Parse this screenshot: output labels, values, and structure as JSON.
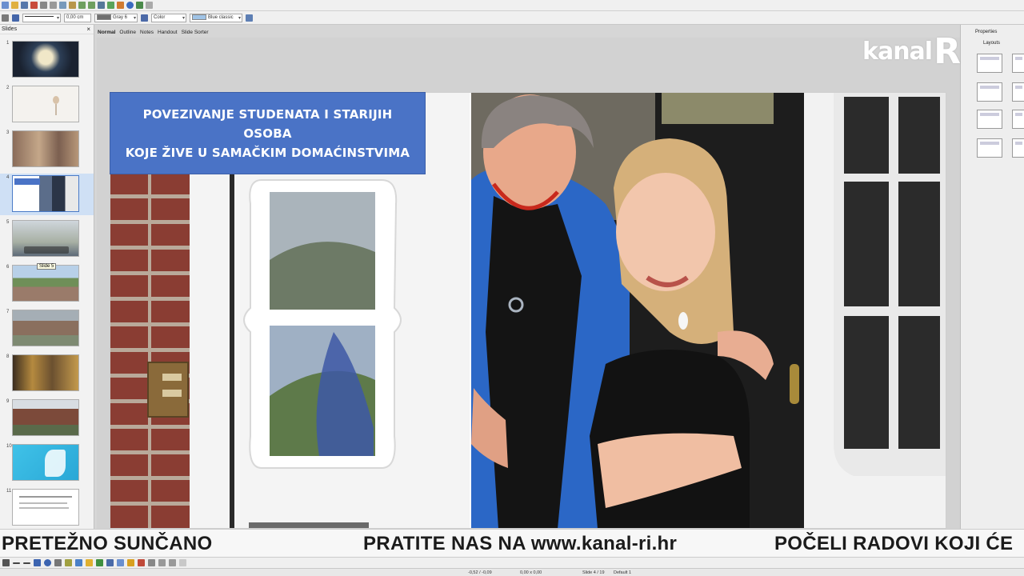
{
  "toolbar": {
    "line_width": "0,00 cm",
    "area_color_name": "Gray 6",
    "area_style": "Color",
    "fill_color_name": "Blue classic"
  },
  "slides_pane": {
    "title": "Slides",
    "close": "×",
    "numbers": [
      "1",
      "2",
      "3",
      "4",
      "5",
      "6",
      "7",
      "8",
      "9",
      "10",
      "11"
    ],
    "tooltip": "Slide 5"
  },
  "view_tabs": [
    "Normal",
    "Outline",
    "Notes",
    "Handout",
    "Slide Sorter"
  ],
  "slide": {
    "title_line1": "POVEZIVANJE STUDENATA I STARIJIH OSOBA",
    "title_line2": "KOJE ŽIVE U SAMAČKIM DOMAĆINSTVIMA"
  },
  "properties": {
    "title": "Properties",
    "layouts_label": "Layouts"
  },
  "logo": {
    "text": "kanal",
    "letter": "R"
  },
  "ticker": {
    "items": [
      "PRETEŽNO SUNČANO",
      "PRATITE NAS NA  www.kanal-ri.hr",
      "POČELI RADOVI KOJI ĆE"
    ]
  },
  "status": {
    "position": "-0,52 / -0,09",
    "size": "0,00 x 0,00",
    "slide": "Slide 4 / 19",
    "layout": "Default 1"
  },
  "colors": {
    "title_bg": "#4a73c6",
    "selected_thumb": "#cfe0f5",
    "ticker_text": "#1b1b1b"
  }
}
